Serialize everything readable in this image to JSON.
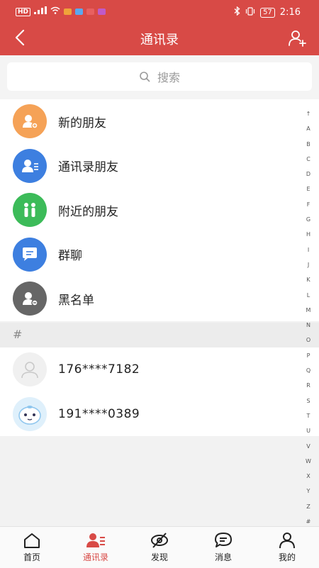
{
  "status_bar": {
    "left_text": "HD",
    "battery": "57",
    "time": "2:16"
  },
  "header": {
    "title": "通讯录"
  },
  "search": {
    "placeholder": "搜索"
  },
  "menu": [
    {
      "label": "新的朋友",
      "color": "#f5a257",
      "icon": "new-friend-icon"
    },
    {
      "label": "通讯录朋友",
      "color": "#3d7fe0",
      "icon": "contacts-friend-icon"
    },
    {
      "label": "附近的朋友",
      "color": "#3cbb59",
      "icon": "nearby-people-icon"
    },
    {
      "label": "群聊",
      "color": "#3d7fe0",
      "icon": "group-chat-icon"
    },
    {
      "label": "黑名单",
      "color": "#666666",
      "icon": "blacklist-icon"
    }
  ],
  "section_header": "#",
  "contacts": [
    {
      "name": "176****7182",
      "avatar": "default-avatar-icon"
    },
    {
      "name": "191****0389",
      "avatar": "cartoon-avatar-icon"
    }
  ],
  "index_letters": [
    "↑",
    "A",
    "B",
    "C",
    "D",
    "E",
    "F",
    "G",
    "H",
    "I",
    "J",
    "K",
    "L",
    "M",
    "N",
    "O",
    "P",
    "Q",
    "R",
    "S",
    "T",
    "U",
    "V",
    "W",
    "X",
    "Y",
    "Z",
    "#"
  ],
  "bottom_nav": [
    {
      "label": "首页",
      "icon": "home-icon",
      "active": false
    },
    {
      "label": "通讯录",
      "icon": "contacts-icon",
      "active": true
    },
    {
      "label": "发现",
      "icon": "discover-icon",
      "active": false
    },
    {
      "label": "消息",
      "icon": "message-icon",
      "active": false
    },
    {
      "label": "我的",
      "icon": "profile-icon",
      "active": false
    }
  ],
  "colors": {
    "accent": "#d84a46",
    "background": "#f2f2f2"
  }
}
